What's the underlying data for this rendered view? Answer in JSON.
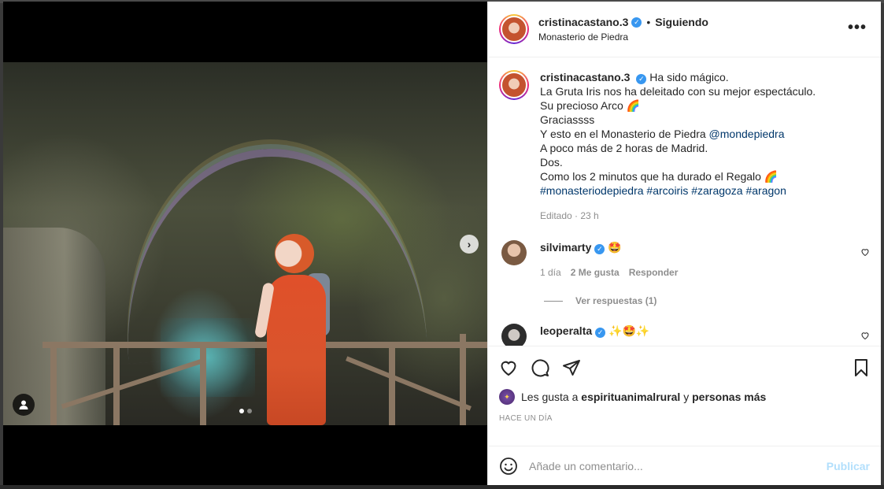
{
  "post": {
    "author": "cristinacastano.3",
    "separator": "•",
    "follow_status": "Siguiendo",
    "location": "Monasterio de Piedra",
    "more_label": "•••",
    "verified_mark": "✓"
  },
  "caption": {
    "username": "cristinacastano.3",
    "lines": [
      "Ha sido mágico.",
      "La Gruta Iris nos ha deleitado con su mejor espectáculo.",
      "Su precioso Arco 🌈",
      "Graciassss",
      "Y esto en el Monasterio de Piedra",
      "A poco más de 2 horas de Madrid.",
      "Dos.",
      "Como los 2 minutos que ha durado el Regalo 🌈"
    ],
    "mention": "@mondepiedra",
    "hashtags": "#monasteriodepiedra #arcoiris #zaragoza #aragon",
    "meta": "Editado · 23 h"
  },
  "comments": [
    {
      "username": "silvimarty",
      "text": "🤩",
      "time": "1 día",
      "likes": "2 Me gusta",
      "reply": "Responder",
      "view_replies": "Ver respuestas (1)"
    },
    {
      "username": "leoperalta",
      "text": "✨🤩✨"
    }
  ],
  "actions": {
    "likes_prefix": "Les gusta a",
    "liker": "espirituanimalrural",
    "likes_joiner": "y",
    "likes_suffix": "personas más",
    "timestamp": "HACE UN DÍA"
  },
  "composer": {
    "placeholder": "Añade un comentario...",
    "publish": "Publicar"
  },
  "media": {
    "next_label": "›",
    "slide_count": 2,
    "active_slide": 1
  },
  "colors": {
    "verified": "#3897f0",
    "link": "#00376b",
    "publish_disabled": "#b2dffc",
    "muted": "#8e8e8e"
  }
}
